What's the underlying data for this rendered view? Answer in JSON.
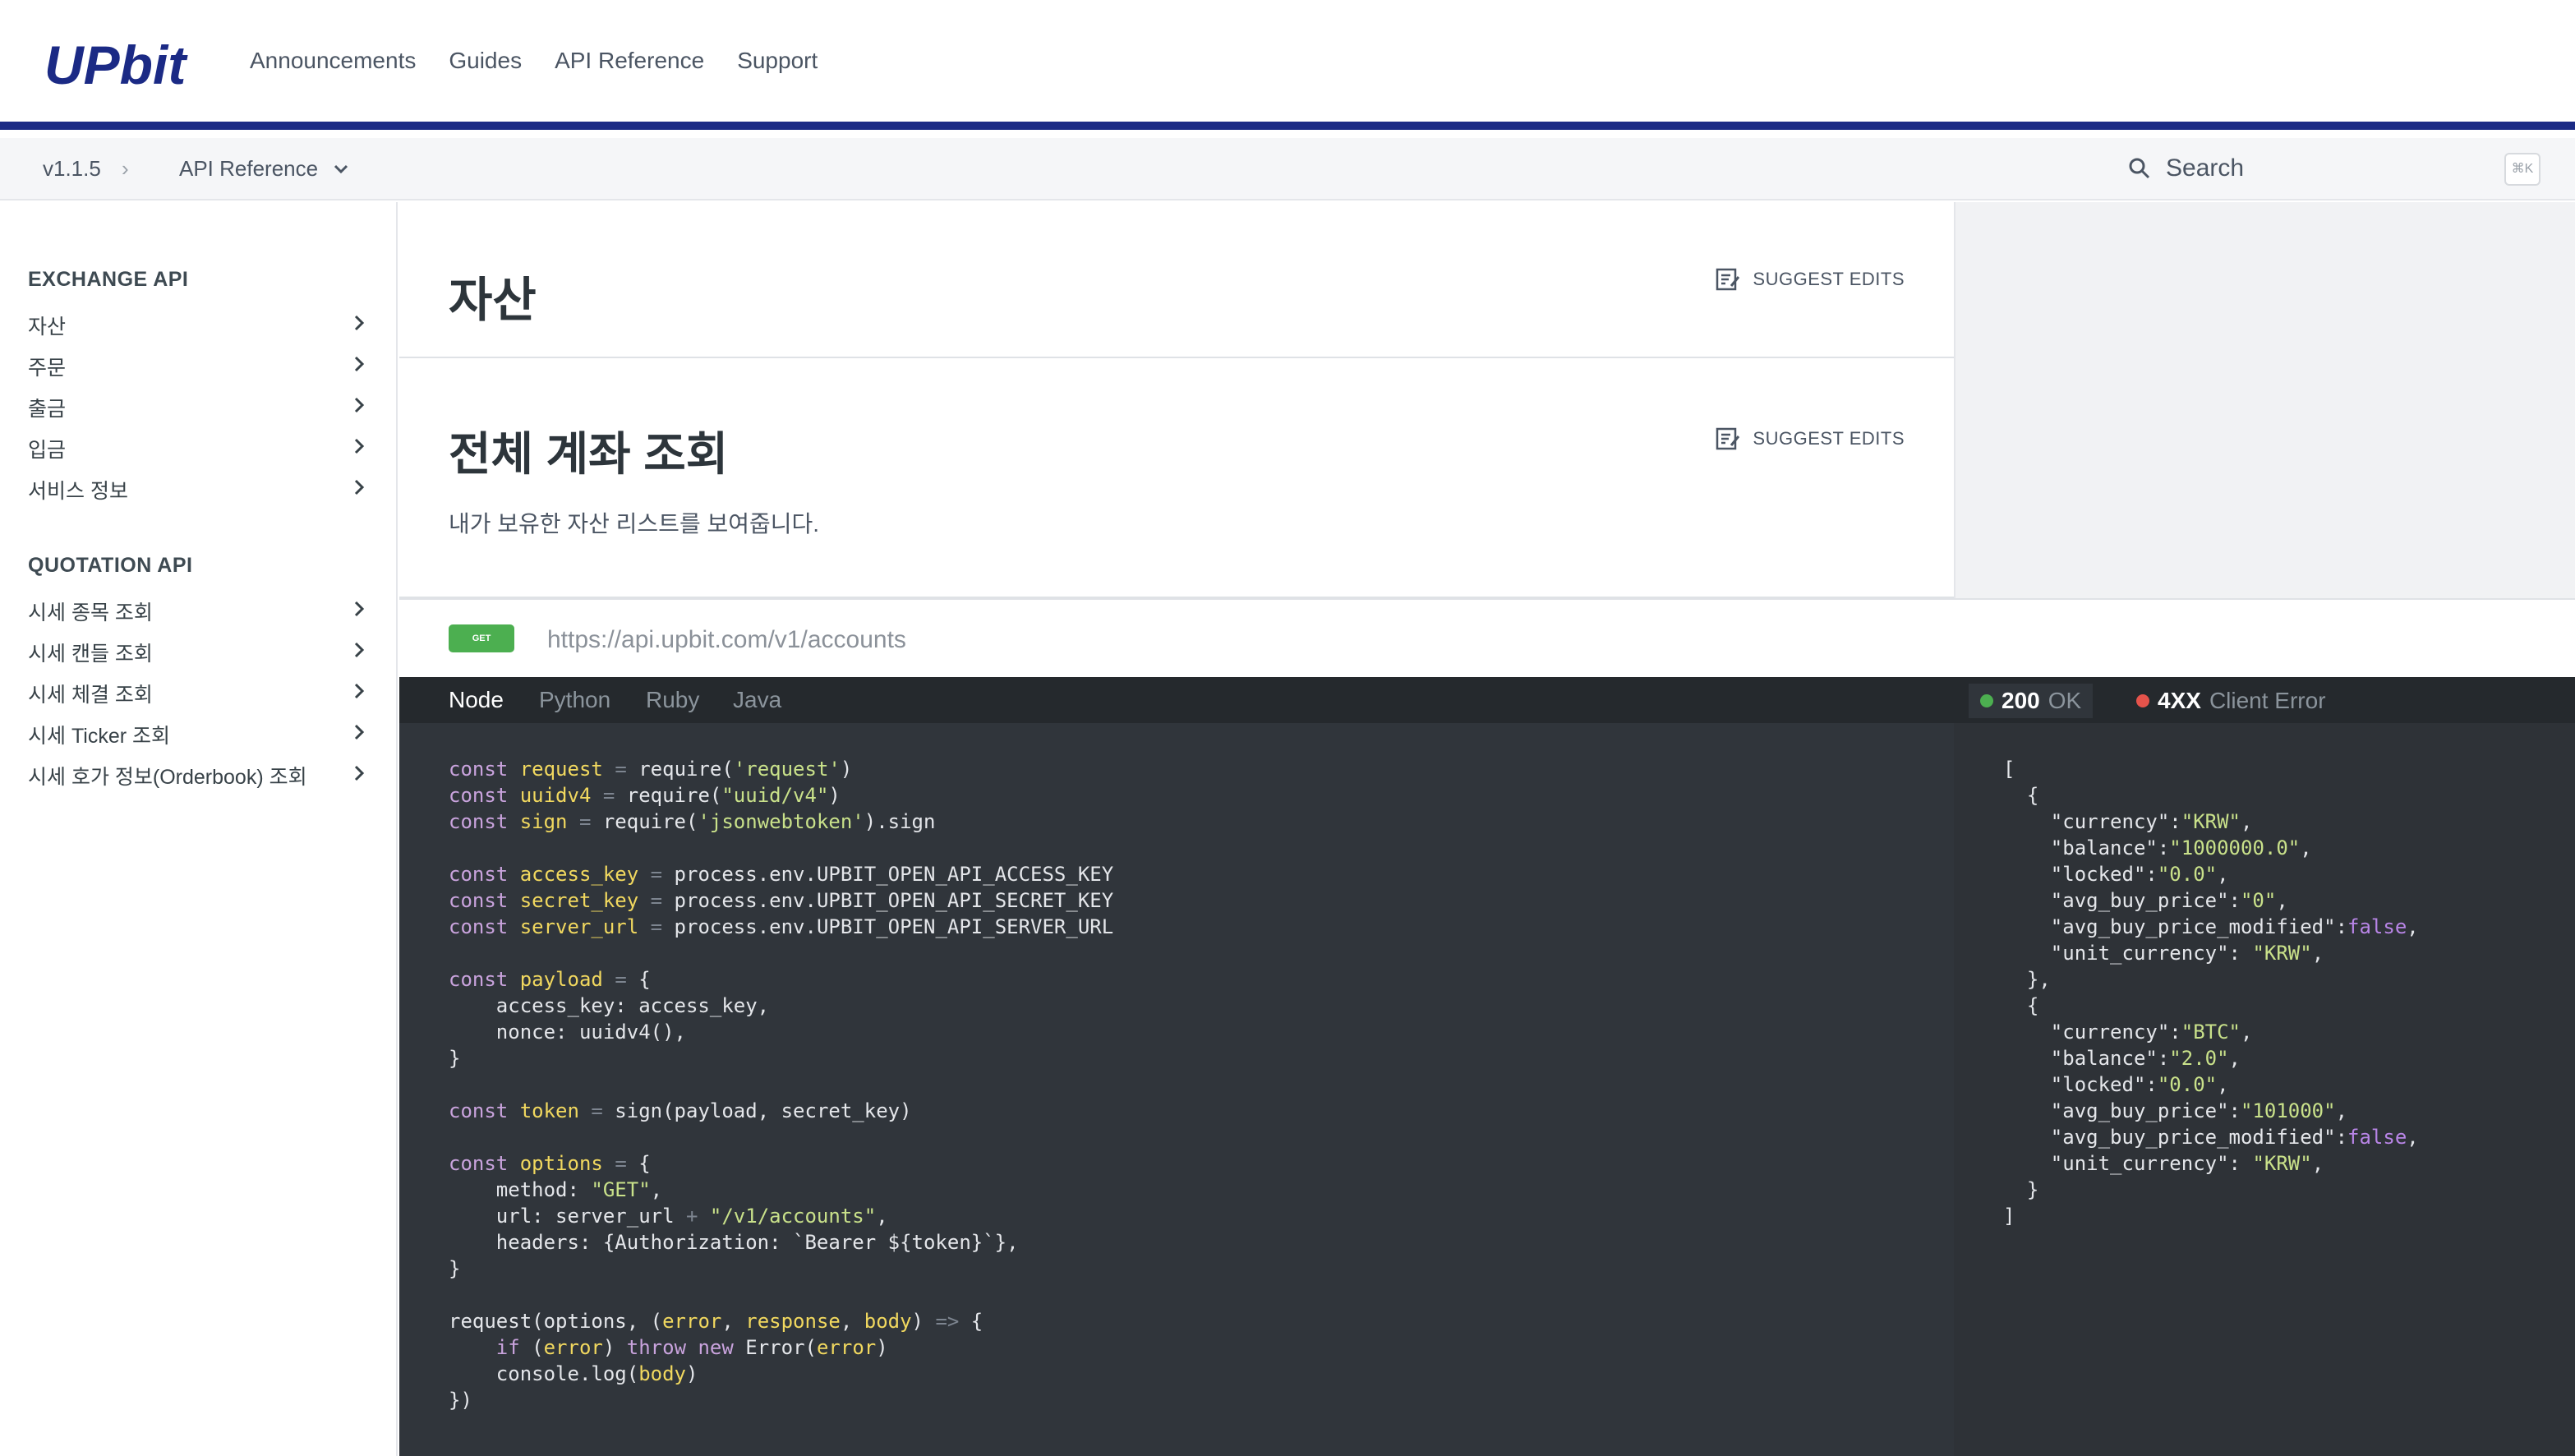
{
  "header": {
    "logo_text": "UPbit",
    "nav": [
      "Announcements",
      "Guides",
      "API Reference",
      "Support"
    ],
    "brand_color": "#1b2a85"
  },
  "subheader": {
    "version": "v1.1.5",
    "section_select": "API Reference",
    "search_placeholder": "Search",
    "shortcut": "⌘K"
  },
  "sidebar": {
    "sections": [
      {
        "heading": "EXCHANGE API",
        "items": [
          "자산",
          "주문",
          "출금",
          "입금",
          "서비스 정보"
        ]
      },
      {
        "heading": "QUOTATION API",
        "items": [
          "시세 종목 조회",
          "시세 캔들 조회",
          "시세 체결 조회",
          "시세 Ticker 조회",
          "시세 호가 정보(Orderbook) 조회"
        ]
      }
    ]
  },
  "page": {
    "title": "자산",
    "suggest_edits": "SUGGEST EDITS",
    "section_title": "전체 계좌 조회",
    "section_description": "내가 보유한 자산 리스트를 보여줍니다.",
    "method": "GET",
    "url": "https://api.upbit.com/v1/accounts"
  },
  "code": {
    "tabs": [
      "Node",
      "Python",
      "Ruby",
      "Java"
    ],
    "active_tab": "Node"
  },
  "response": {
    "tabs": [
      {
        "code": "200",
        "label": "OK",
        "dot_color": "#4caf50"
      },
      {
        "code": "4XX",
        "label": "Client Error",
        "dot_color": "#e5534b"
      }
    ]
  }
}
